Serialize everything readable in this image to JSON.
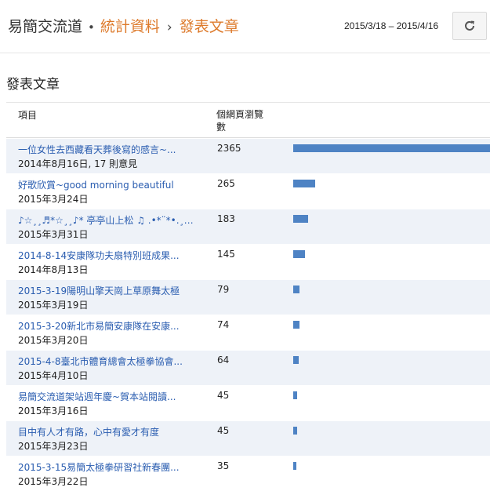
{
  "header": {
    "crumb_root": "易簡交流道",
    "crumb_stats": "統計資料",
    "crumb_current": "發表文章",
    "date_range": "2015/3/18 – 2015/4/16",
    "refresh_icon": "refresh-icon"
  },
  "section": {
    "title": "發表文章"
  },
  "table": {
    "col_item": "項目",
    "col_views": "個網頁瀏覽數",
    "bar_color": "#4e83c4",
    "max_views": 2365,
    "rows": [
      {
        "title": "一位女性去西藏看天葬後寫的感言~...",
        "meta": "2014年8月16日, 17 則意見",
        "views": 2365
      },
      {
        "title": "好歌欣賞~good morning beautiful",
        "meta": "2015年3月24日",
        "views": 265
      },
      {
        "title": "♪☆¸¸♬*☆¸¸♪* 亭亭山上松 ♫ .•*¨*•.¸¸...",
        "meta": "2015年3月31日",
        "views": 183
      },
      {
        "title": "2014-8-14安康隊功夫扇特別班成果...",
        "meta": "2014年8月13日",
        "views": 145
      },
      {
        "title": "2015-3-19陽明山擎天崗上草原舞太極",
        "meta": "2015年3月19日",
        "views": 79
      },
      {
        "title": "2015-3-20新北市易簡安康隊在安康...",
        "meta": "2015年3月20日",
        "views": 74
      },
      {
        "title": "2015-4-8臺北市體育總會太極拳協會...",
        "meta": "2015年4月10日",
        "views": 64
      },
      {
        "title": "易簡交流道架站週年慶~賀本站閱讀...",
        "meta": "2015年3月16日",
        "views": 45
      },
      {
        "title": "目中有人才有路，心中有愛才有度",
        "meta": "2015年3月23日",
        "views": 45
      },
      {
        "title": "2015-3-15易簡太極拳研習社新春團...",
        "meta": "2015年3月22日",
        "views": 35
      }
    ]
  }
}
